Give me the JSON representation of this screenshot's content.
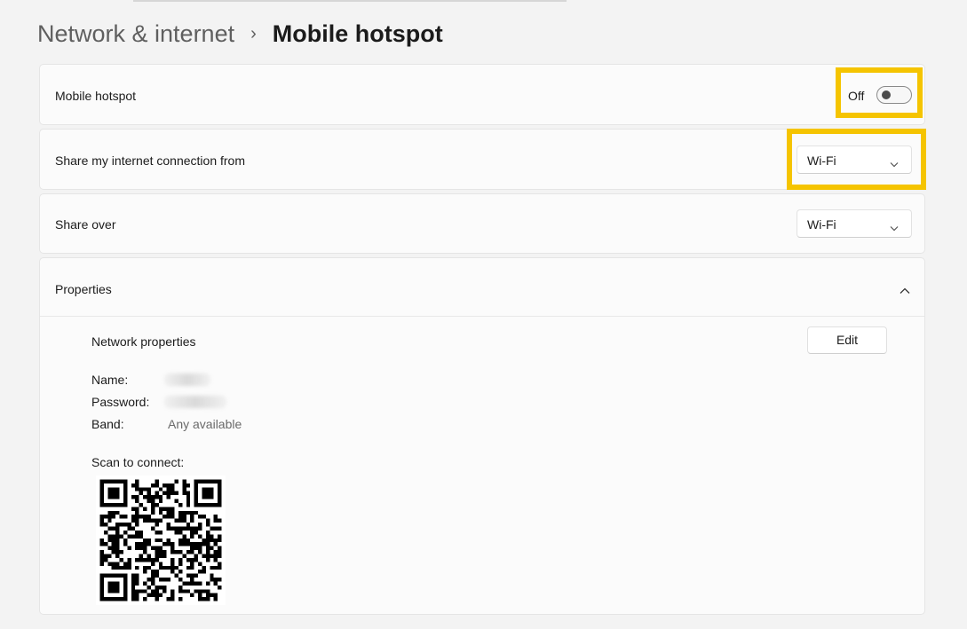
{
  "breadcrumb": {
    "parent": "Network & internet",
    "separator": "›",
    "current": "Mobile hotspot"
  },
  "hotspot_row": {
    "label": "Mobile hotspot",
    "toggle_state": "Off",
    "toggle_on": false
  },
  "share_from_row": {
    "label": "Share my internet connection from",
    "selected": "Wi-Fi"
  },
  "share_over_row": {
    "label": "Share over",
    "selected": "Wi-Fi"
  },
  "properties": {
    "header": "Properties",
    "expanded": true,
    "network_properties_label": "Network properties",
    "edit_label": "Edit",
    "name_label": "Name:",
    "password_label": "Password:",
    "band_label": "Band:",
    "band_value": "Any available",
    "scan_label": "Scan to connect:"
  },
  "colors": {
    "highlight": "#f5c400",
    "background": "#f3f3f3",
    "card": "#fbfbfb"
  },
  "icons": {
    "breadcrumb_separator": "chevron-right-icon",
    "dropdown": "chevron-down-icon",
    "collapse": "chevron-up-icon"
  }
}
